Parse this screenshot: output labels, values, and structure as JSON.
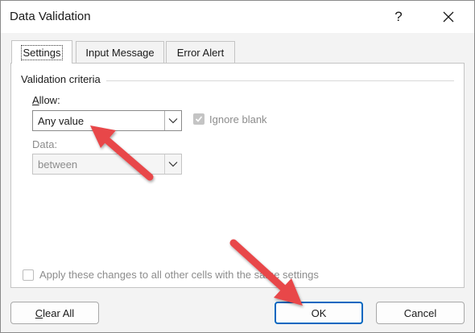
{
  "window": {
    "title": "Data Validation",
    "help_label": "?"
  },
  "tabs": [
    {
      "label": "Settings",
      "active": true
    },
    {
      "label": "Input Message",
      "active": false
    },
    {
      "label": "Error Alert",
      "active": false
    }
  ],
  "settings": {
    "group_title": "Validation criteria",
    "allow_label_prefix": "A",
    "allow_label_rest": "llow:",
    "allow_value": "Any value",
    "ignore_blank_label": "Ignore blank",
    "ignore_blank_checked": true,
    "data_label": "Data:",
    "data_value": "between",
    "apply_label": "Apply these changes to all other cells with the same settings",
    "apply_checked": false
  },
  "buttons": {
    "clear_prefix": "C",
    "clear_rest": "lear All",
    "ok": "OK",
    "cancel": "Cancel"
  },
  "colors": {
    "accent": "#0067c0",
    "arrow": "#e8464a"
  }
}
